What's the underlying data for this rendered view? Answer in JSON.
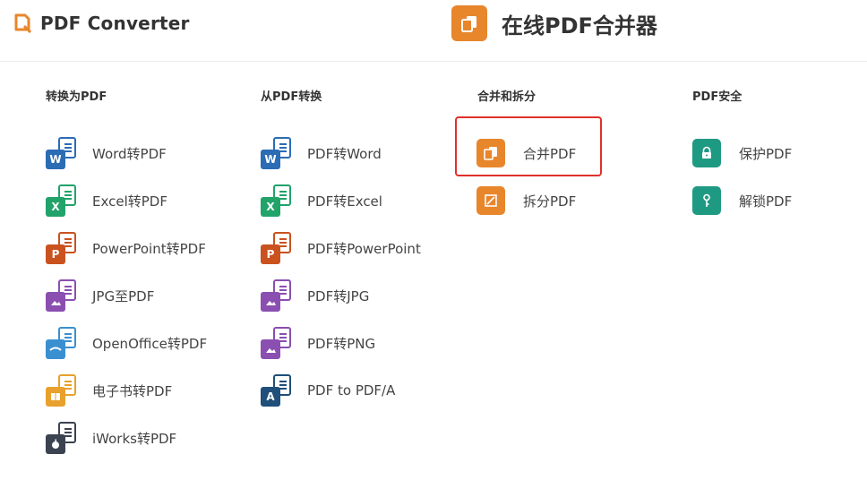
{
  "header": {
    "logo_text": "PDF Converter",
    "page_title": "在线PDF合并器",
    "accent": "#e8862c"
  },
  "columns": [
    {
      "title": "转换为PDF",
      "items": [
        {
          "label": "Word转PDF",
          "icon": "word-icon",
          "color": "#2b6cb5",
          "badge": "W"
        },
        {
          "label": "Excel转PDF",
          "icon": "excel-icon",
          "color": "#21a36a",
          "badge": "X"
        },
        {
          "label": "PowerPoint转PDF",
          "icon": "powerpoint-icon",
          "color": "#c9521f",
          "badge": "P"
        },
        {
          "label": "JPG至PDF",
          "icon": "jpg-icon",
          "color": "#8a4fb0",
          "badge": ""
        },
        {
          "label": "OpenOffice转PDF",
          "icon": "openoffice-icon",
          "color": "#3a8fd0",
          "badge": ""
        },
        {
          "label": "电子书转PDF",
          "icon": "ebook-icon",
          "color": "#e8a12c",
          "badge": ""
        },
        {
          "label": "iWorks转PDF",
          "icon": "iworks-icon",
          "color": "#3b4350",
          "badge": ""
        }
      ]
    },
    {
      "title": "从PDF转换",
      "items": [
        {
          "label": "PDF转Word",
          "icon": "word-icon",
          "color": "#2b6cb5",
          "badge": "W"
        },
        {
          "label": "PDF转Excel",
          "icon": "excel-icon",
          "color": "#21a36a",
          "badge": "X"
        },
        {
          "label": "PDF转PowerPoint",
          "icon": "powerpoint-icon",
          "color": "#c9521f",
          "badge": "P"
        },
        {
          "label": "PDF转JPG",
          "icon": "jpg-icon",
          "color": "#8a4fb0",
          "badge": ""
        },
        {
          "label": "PDF转PNG",
          "icon": "png-icon",
          "color": "#8a4fb0",
          "badge": ""
        },
        {
          "label": "PDF to PDF/A",
          "icon": "pdfa-icon",
          "color": "#1f4f7a",
          "badge": "A"
        }
      ]
    },
    {
      "title": "合并和拆分",
      "items": [
        {
          "label": "合并PDF",
          "icon": "merge-icon",
          "color": "#e8862c"
        },
        {
          "label": "拆分PDF",
          "icon": "split-icon",
          "color": "#e8862c"
        }
      ]
    },
    {
      "title": "PDF安全",
      "items": [
        {
          "label": "保护PDF",
          "icon": "lock-icon",
          "color": "#1f9a82"
        },
        {
          "label": "解锁PDF",
          "icon": "key-icon",
          "color": "#1f9a82"
        }
      ]
    }
  ]
}
